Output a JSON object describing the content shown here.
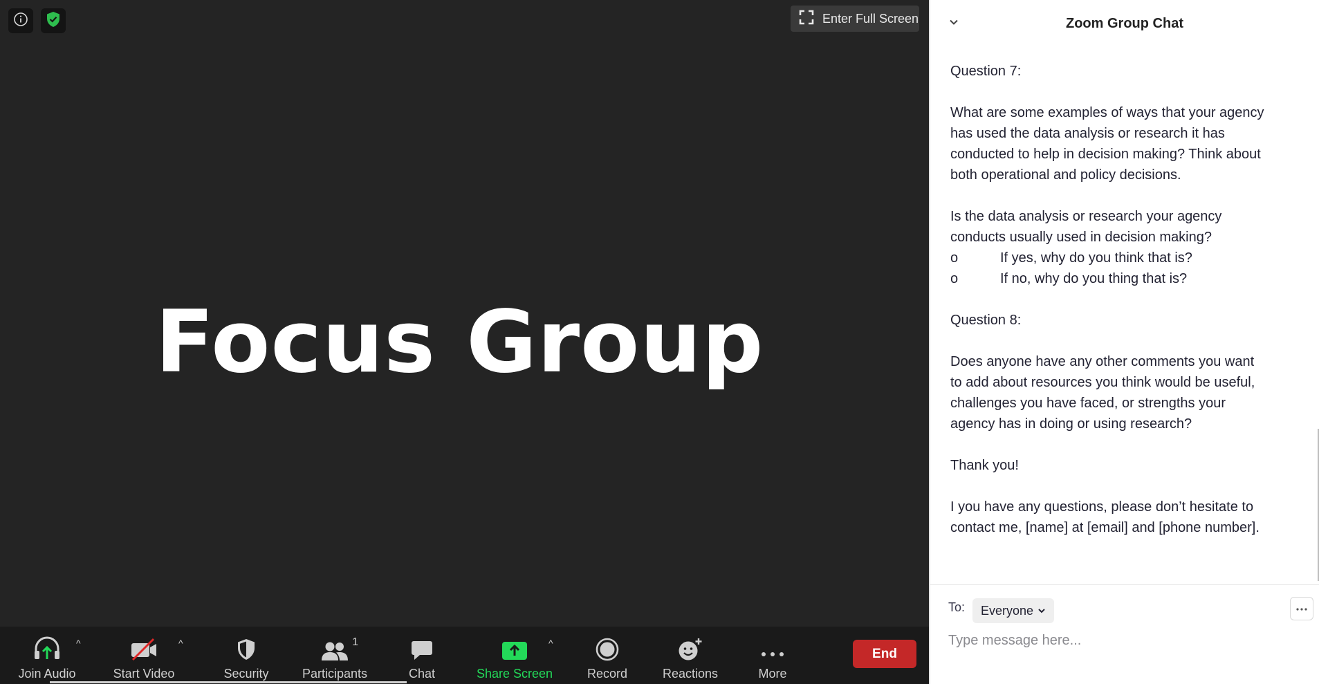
{
  "meeting": {
    "fullscreen_label": "Enter Full Screen",
    "shared_title": "Focus Group"
  },
  "toolbar": {
    "join_audio": "Join Audio",
    "start_video": "Start Video",
    "security": "Security",
    "participants": "Participants",
    "participants_count": "1",
    "chat": "Chat",
    "share_screen": "Share Screen",
    "record": "Record",
    "reactions": "Reactions",
    "more": "More",
    "end": "End",
    "caret": "^"
  },
  "chat": {
    "title": "Zoom Group Chat",
    "message": {
      "q7_heading": "Question 7:",
      "q7_line1": "What are some examples of ways that your agency",
      "q7_line2": "has used the data analysis or research it has",
      "q7_line3": "conducted to help in decision making? Think about",
      "q7_line4": "both operational and policy decisions.",
      "q7b_line1": "Is the data analysis or research your agency",
      "q7b_line2": "conducts usually used in decision making?",
      "bullet_marker": "o",
      "bullet1": "If yes, why do you think that is?",
      "bullet2": "If no, why do you thing that is?",
      "q8_heading": "Question 8:",
      "q8_line1": "Does anyone have any other comments you want",
      "q8_line2": "to add about resources you think would be useful,",
      "q8_line3": "challenges you have faced, or strengths your",
      "q8_line4": "agency has in doing or using research?",
      "thanks": "Thank you!",
      "contact_line1": "I you have any questions, please don’t hesitate to",
      "contact_line2": "contact me, [name] at [email] and [phone number]."
    },
    "to_label": "To:",
    "recipient": "Everyone",
    "input_placeholder": "Type message here..."
  },
  "colors": {
    "share_green": "#23d959",
    "end_red": "#c42828",
    "shield_green": "#2ebd4e"
  }
}
